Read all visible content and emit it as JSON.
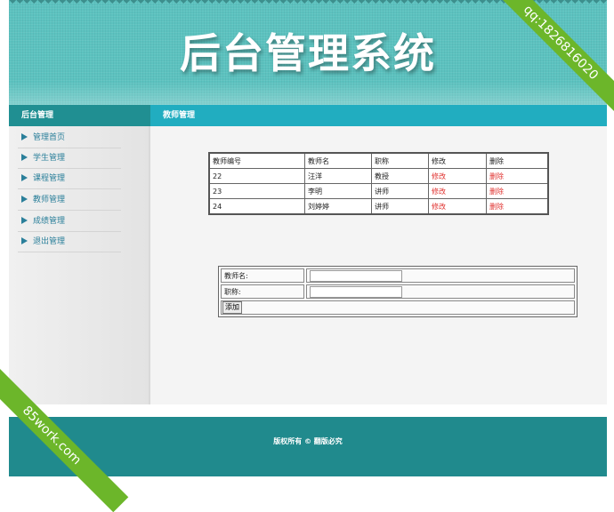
{
  "header": {
    "title": "后台管理系统"
  },
  "sidebar": {
    "heading": "后台管理",
    "items": [
      {
        "label": "管理首页"
      },
      {
        "label": "学生管理"
      },
      {
        "label": "课程管理"
      },
      {
        "label": "教师管理"
      },
      {
        "label": "成绩管理"
      },
      {
        "label": "退出管理"
      }
    ]
  },
  "main": {
    "heading": "教师管理",
    "table": {
      "headers": [
        "教师编号",
        "教师名",
        "职称",
        "修改",
        "删除"
      ],
      "rows": [
        {
          "id": "22",
          "name": "汪洋",
          "title": "教授",
          "edit": "修改",
          "delete": "删除"
        },
        {
          "id": "23",
          "name": "李明",
          "title": "讲师",
          "edit": "修改",
          "delete": "删除"
        },
        {
          "id": "24",
          "name": "刘婷婷",
          "title": "讲师",
          "edit": "修改",
          "delete": "删除"
        }
      ]
    },
    "form": {
      "name_label": "教师名:",
      "name_value": "",
      "title_label": "职称:",
      "title_value": "",
      "submit_label": "添加"
    }
  },
  "footer": {
    "text": "版权所有 © 翻版必究"
  },
  "watermarks": {
    "top_right": "qq:1826816020",
    "bottom_left": "85work.com"
  },
  "colors": {
    "header_bg": "#5cc2bf",
    "sidebar_bar": "#208f92",
    "content_bar": "#21adc0",
    "footer_bg": "#208a8d",
    "link_red": "#e0312e",
    "ribbon_green": "#6cb62a"
  }
}
